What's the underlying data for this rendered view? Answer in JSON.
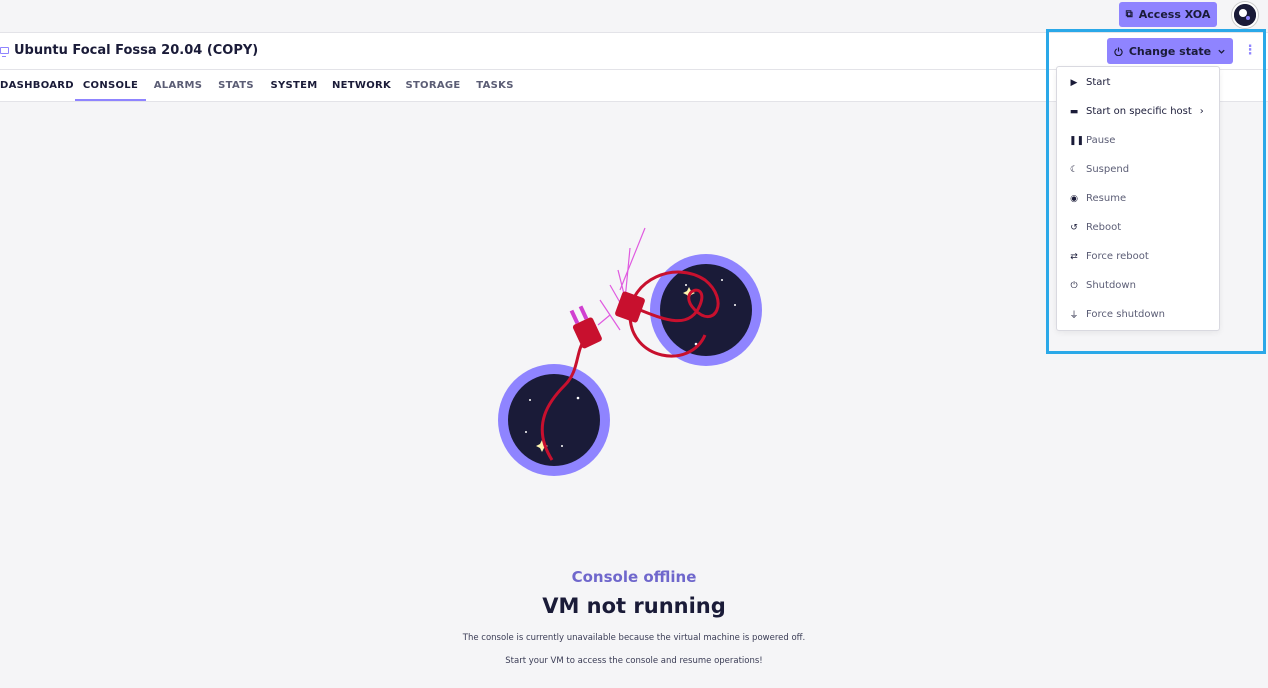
{
  "topbar": {
    "access_label": "Access XOA",
    "access_icon": "external-link-icon"
  },
  "header": {
    "vm_title": "Ubuntu Focal Fossa 20.04 (COPY)",
    "change_state_label": "Change state",
    "more_icon": "kebab-icon"
  },
  "tabs": [
    {
      "label": "DASHBOARD",
      "active": false
    },
    {
      "label": "CONSOLE",
      "active": true
    },
    {
      "label": "ALARMS",
      "active": false
    },
    {
      "label": "STATS",
      "active": false
    },
    {
      "label": "SYSTEM",
      "active": false
    },
    {
      "label": "NETWORK",
      "active": false
    },
    {
      "label": "STORAGE",
      "active": false
    },
    {
      "label": "TASKS",
      "active": false
    }
  ],
  "menu": {
    "items": [
      {
        "label": "Start",
        "icon": "play-icon"
      },
      {
        "label": "Start on specific host",
        "icon": "server-icon",
        "submenu": true
      },
      {
        "label": "Pause",
        "icon": "pause-icon"
      },
      {
        "label": "Suspend",
        "icon": "moon-icon"
      },
      {
        "label": "Resume",
        "icon": "circle-play-icon"
      },
      {
        "label": "Reboot",
        "icon": "rotate-icon"
      },
      {
        "label": "Force reboot",
        "icon": "repeat-icon"
      },
      {
        "label": "Shutdown",
        "icon": "power-icon"
      },
      {
        "label": "Force shutdown",
        "icon": "plug-icon"
      }
    ]
  },
  "message": {
    "subtitle": "Console offline",
    "title": "VM not running",
    "line1": "The console is currently unavailable because the virtual machine is powered off.",
    "line2": "Start your VM to access the console and resume operations!"
  },
  "colors": {
    "accent": "#8f84ff",
    "text": "#1a1b38",
    "plug_red": "#c8102e",
    "highlight": "#2aa8e8"
  }
}
